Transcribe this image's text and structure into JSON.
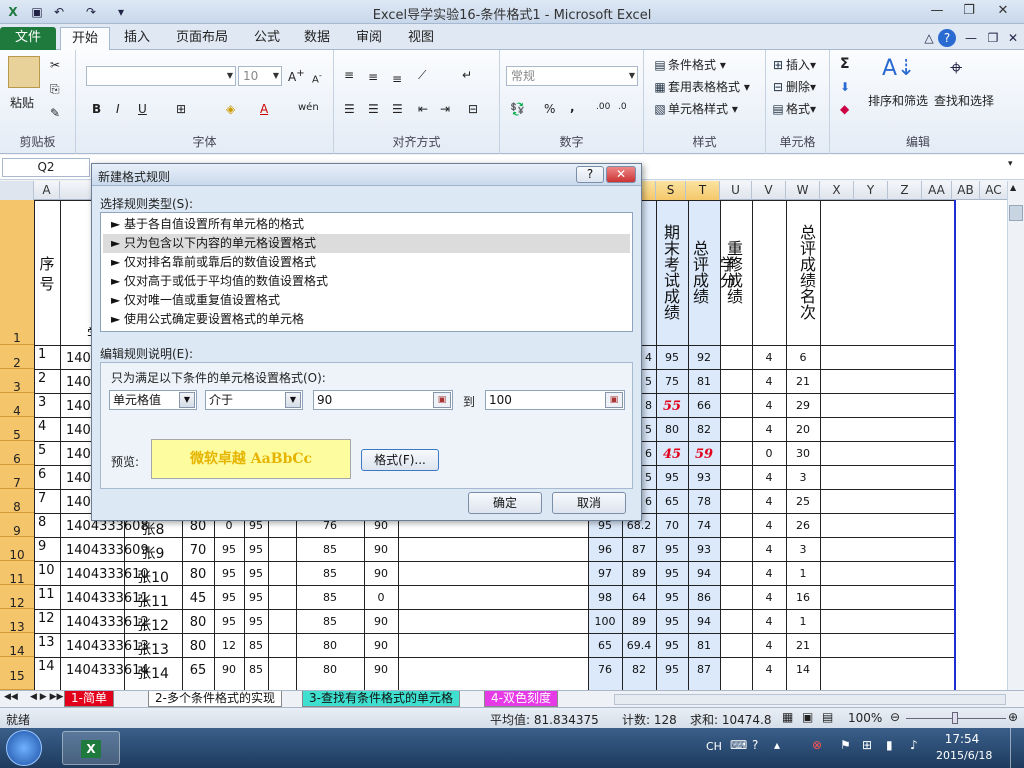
{
  "window": {
    "title": "Excel导学实验16-条件格式1 - Microsoft Excel"
  },
  "tabs": [
    "文件",
    "开始",
    "插入",
    "页面布局",
    "公式",
    "数据",
    "审阅",
    "视图"
  ],
  "ribbon": {
    "clipboard": {
      "paste": "粘贴",
      "label": "剪贴板"
    },
    "font": {
      "size": "10",
      "label": "字体",
      "bold": "B",
      "italic": "I",
      "underline": "U"
    },
    "alignment": {
      "label": "对齐方式"
    },
    "number": {
      "format": "常规",
      "label": "数字",
      "percent": "%",
      "comma": ","
    },
    "styles": {
      "conditional": "条件格式",
      "table": "套用表格格式",
      "cell": "单元格样式",
      "label": "样式"
    },
    "cells": {
      "insert": "插入",
      "delete": "删除",
      "format": "格式",
      "label": "单元格"
    },
    "editing": {
      "sum": "Σ",
      "sort": "排序和筛选",
      "find": "查找和选择",
      "label": "编辑"
    }
  },
  "namebox": "Q2",
  "columns": [
    "A",
    "R",
    "S",
    "T",
    "U",
    "V",
    "W",
    "X",
    "Y",
    "Z",
    "AA",
    "AB",
    "AC"
  ],
  "row_numbers": [
    "1",
    "2",
    "3",
    "4",
    "5",
    "6",
    "7",
    "8",
    "9",
    "10",
    "11",
    "12",
    "13",
    "14",
    "15"
  ],
  "header_row": {
    "seq": "序号",
    "student_prefix": "学",
    "s": "期末考试成绩",
    "t": "总评成绩",
    "u": "重修成绩",
    "v": "学分",
    "w": "总评成绩名次"
  },
  "rows": [
    {
      "seq": "1",
      "id": "140",
      "name": "",
      "c1": "",
      "c2": "",
      "c3": "",
      "c4": "",
      "c5": "",
      "r": "4",
      "s": "95",
      "t": "92",
      "v": "4",
      "w": "6"
    },
    {
      "seq": "2",
      "id": "140",
      "name": "",
      "c1": "",
      "c2": "",
      "c3": "",
      "c4": "",
      "c5": "",
      "r": "5",
      "s": "75",
      "t": "81",
      "v": "4",
      "w": "21"
    },
    {
      "seq": "3",
      "id": "140",
      "name": "",
      "c1": "",
      "c2": "",
      "c3": "",
      "c4": "",
      "c5": "",
      "r": "8",
      "s": "55",
      "t": "66",
      "v": "4",
      "w": "29"
    },
    {
      "seq": "4",
      "id": "140",
      "name": "",
      "c1": "",
      "c2": "",
      "c3": "",
      "c4": "",
      "c5": "",
      "r": "5",
      "s": "80",
      "t": "82",
      "v": "4",
      "w": "20"
    },
    {
      "seq": "5",
      "id": "140",
      "name": "",
      "c1": "",
      "c2": "",
      "c3": "",
      "c4": "",
      "c5": "",
      "r": "6",
      "s": "45",
      "t": "59",
      "v": "0",
      "w": "30"
    },
    {
      "seq": "6",
      "id": "140",
      "name": "",
      "c1": "",
      "c2": "",
      "c3": "",
      "c4": "",
      "c5": "",
      "r": "5",
      "s": "95",
      "t": "93",
      "v": "4",
      "w": "3"
    },
    {
      "seq": "7",
      "id": "140",
      "name": "",
      "c1": "",
      "c2": "",
      "c3": "",
      "c4": "",
      "c5": "",
      "r": "6",
      "s": "65",
      "t": "78",
      "v": "4",
      "w": "25"
    },
    {
      "seq": "8",
      "id": "1404333608",
      "name": "张8",
      "c1": "80",
      "c2": "0",
      "c3": "95",
      "c4": "76",
      "c5": "90",
      "q": "95",
      "r": "68.2",
      "s": "70",
      "t": "74",
      "v": "4",
      "w": "26"
    },
    {
      "seq": "9",
      "id": "1404333609",
      "name": "张9",
      "c1": "70",
      "c2": "95",
      "c3": "95",
      "c4": "85",
      "c5": "90",
      "q": "96",
      "r": "87",
      "s": "95",
      "t": "93",
      "v": "4",
      "w": "3"
    },
    {
      "seq": "10",
      "id": "1404333610",
      "name": "张10",
      "c1": "80",
      "c2": "95",
      "c3": "95",
      "c4": "85",
      "c5": "90",
      "q": "97",
      "r": "89",
      "s": "95",
      "t": "94",
      "v": "4",
      "w": "1"
    },
    {
      "seq": "11",
      "id": "1404333611",
      "name": "张11",
      "c1": "45",
      "c2": "95",
      "c3": "95",
      "c4": "85",
      "c5": "0",
      "q": "98",
      "r": "64",
      "s": "95",
      "t": "86",
      "v": "4",
      "w": "16"
    },
    {
      "seq": "12",
      "id": "1404333612",
      "name": "张12",
      "c1": "80",
      "c2": "95",
      "c3": "95",
      "c4": "85",
      "c5": "90",
      "q": "100",
      "r": "89",
      "s": "95",
      "t": "94",
      "v": "4",
      "w": "1"
    },
    {
      "seq": "13",
      "id": "1404333613",
      "name": "张13",
      "c1": "80",
      "c2": "12",
      "c3": "85",
      "c4": "80",
      "c5": "90",
      "q": "65",
      "r": "69.4",
      "s": "95",
      "t": "81",
      "v": "4",
      "w": "21"
    },
    {
      "seq": "14",
      "id": "1404333614",
      "name": "张14",
      "c1": "65",
      "c2": "90",
      "c3": "85",
      "c4": "80",
      "c5": "90",
      "q": "76",
      "r": "82",
      "s": "95",
      "t": "87",
      "v": "4",
      "w": "14"
    }
  ],
  "dialog": {
    "title": "新建格式规则",
    "select_type_label": "选择规则类型(S):",
    "rules": [
      "基于各自值设置所有单元格的格式",
      "只为包含以下内容的单元格设置格式",
      "仅对排名靠前或靠后的数值设置格式",
      "仅对高于或低于平均值的数值设置格式",
      "仅对唯一值或重复值设置格式",
      "使用公式确定要设置格式的单元格"
    ],
    "edit_label": "编辑规则说明(E):",
    "condition_label": "只为满足以下条件的单元格设置格式(O):",
    "field1": "单元格值",
    "field2": "介于",
    "value1": "90",
    "to_label": "到",
    "value2": "100",
    "preview_label": "预览:",
    "preview_text": "微软卓越  AaBbCc",
    "format_button": "格式(F)...",
    "ok": "确定",
    "cancel": "取消",
    "help": "?",
    "close": "✕"
  },
  "sheets": [
    "1-简单",
    "2-多个条件格式的实现",
    "3-查找有条件格式的单元格",
    "4-双色刻度"
  ],
  "status": {
    "ready": "就绪",
    "average": "平均值: 81.834375",
    "count": "计数: 128",
    "sum": "求和: 10474.8",
    "zoom": "100%"
  },
  "taskbar": {
    "time": "17:54",
    "date": "2015/6/18",
    "lang": "CH"
  },
  "colors": {
    "accent_green": "#1f7a3e",
    "selected_row": "#f4c56a",
    "blue_col": "#dbe9fb",
    "red_value": "#e0001b"
  }
}
